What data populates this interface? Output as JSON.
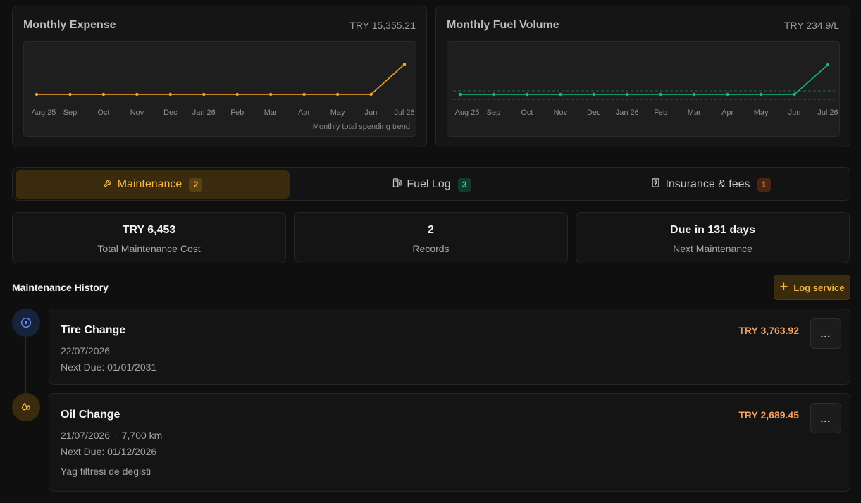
{
  "expense_card": {
    "title": "Monthly Expense",
    "value": "TRY 15,355.21",
    "caption": "Monthly total spending trend"
  },
  "fuel_card": {
    "title": "Monthly Fuel Volume",
    "value": "TRY 234.9/L"
  },
  "colors": {
    "accent": "#f5a623",
    "fuel": "#10b981",
    "amount": "#f59e5b"
  },
  "chart_data": [
    {
      "type": "line",
      "title": "Monthly Expense",
      "categories": [
        "Aug 25",
        "Sep",
        "Oct",
        "Nov",
        "Dec",
        "Jan 26",
        "Feb",
        "Mar",
        "Apr",
        "May",
        "Jun",
        "Jul 26"
      ],
      "values": [
        0,
        0,
        0,
        0,
        0,
        0,
        0,
        0,
        0,
        0,
        0,
        15355.21
      ],
      "ylim": [
        0,
        27000
      ],
      "grid": false,
      "color": "#f5a623"
    },
    {
      "type": "line",
      "title": "Monthly Fuel Volume",
      "categories": [
        "Aug 25",
        "Sep",
        "Oct",
        "Nov",
        "Dec",
        "Jan 26",
        "Feb",
        "Mar",
        "Apr",
        "May",
        "Jun",
        "Jul 26"
      ],
      "values": [
        0,
        0,
        0,
        0,
        0,
        0,
        0,
        0,
        0,
        0,
        0,
        234.9
      ],
      "ylim": [
        0,
        420
      ],
      "grid": true,
      "color": "#10b981"
    }
  ],
  "tabs": [
    {
      "label": "Maintenance",
      "count": "2",
      "icon": "wrench-icon"
    },
    {
      "label": "Fuel Log",
      "count": "3",
      "icon": "fuel-pump-icon"
    },
    {
      "label": "Insurance & fees",
      "count": "1",
      "icon": "receipt-icon"
    }
  ],
  "stats": [
    {
      "value": "TRY 6,453",
      "label": "Total Maintenance Cost"
    },
    {
      "value": "2",
      "label": "Records"
    },
    {
      "value": "Due in 131 days",
      "label": "Next Maintenance"
    }
  ],
  "history": {
    "title": "Maintenance History",
    "log_button": "Log service",
    "records": [
      {
        "title": "Tire Change",
        "amount": "TRY 3,763.92",
        "date": "22/07/2026",
        "next_due": "Next Due: 01/01/2031",
        "icon": "tire-icon"
      },
      {
        "title": "Oil Change",
        "amount": "TRY 2,689.45",
        "date": "21/07/2026",
        "mileage": "7,700 km",
        "next_due": "Next Due: 01/12/2026",
        "note": "Yag filtresi de degisti",
        "icon": "oil-drop-icon"
      }
    ],
    "more_label": "..."
  }
}
